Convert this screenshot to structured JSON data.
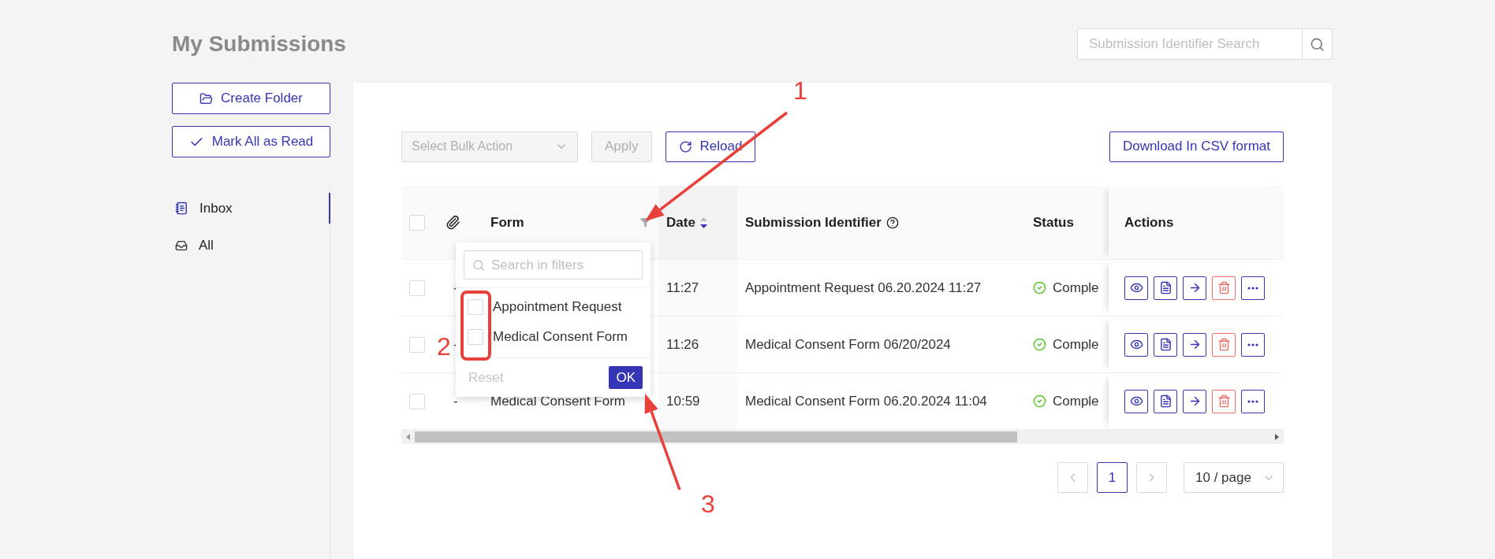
{
  "page": {
    "title": "My Submissions"
  },
  "search": {
    "placeholder": "Submission Identifier Search"
  },
  "sidebar": {
    "buttons": [
      {
        "label": "Create Folder",
        "kind": "folder"
      },
      {
        "label": "Mark All as Read",
        "kind": "check"
      }
    ],
    "items": [
      {
        "label": "Inbox",
        "kind": "inbox",
        "selected": true
      },
      {
        "label": "All",
        "kind": "all",
        "selected": false
      }
    ]
  },
  "toolbar": {
    "bulk_action": {
      "placeholder": "Select Bulk Action",
      "disabled": true
    },
    "apply": {
      "label": "Apply",
      "disabled": true
    },
    "reload": {
      "label": "Reload"
    },
    "download": {
      "label": "Download In CSV format"
    }
  },
  "table": {
    "select_all_checked": false,
    "columns": [
      {
        "kind": "select"
      },
      {
        "kind": "attachment"
      },
      {
        "label": "Form",
        "kind": "filter"
      },
      {
        "label": "Date",
        "kind": "sort",
        "sort_descending": true
      },
      {
        "label": "Submission Identifier",
        "kind": "help"
      },
      {
        "label": "Status",
        "kind": "text"
      },
      {
        "label": "Actions",
        "kind": "text"
      }
    ],
    "rows": [
      {
        "checked": false,
        "attachment": "-",
        "date": "11:27",
        "identifier": "Appointment Request 06.20.2024 11:27",
        "status": "Comple"
      },
      {
        "checked": false,
        "attachment": "-",
        "date": "11:26",
        "identifier": "Medical Consent Form 06/20/2024",
        "status": "Comple"
      },
      {
        "checked": false,
        "attachment": "-",
        "form": "Medical Consent Form",
        "date": "10:59",
        "identifier": "Medical Consent Form 06.20.2024 11:04",
        "status": "Comple"
      }
    ],
    "actions": [
      {
        "kind": "view"
      },
      {
        "kind": "pdf"
      },
      {
        "kind": "forward"
      },
      {
        "kind": "delete"
      },
      {
        "kind": "more"
      }
    ]
  },
  "filter_dropdown": {
    "search_placeholder": "Search in filters",
    "options": [
      {
        "label": "Appointment Request",
        "checked": false
      },
      {
        "label": "Medical Consent Form",
        "checked": false
      }
    ],
    "reset": {
      "label": "Reset",
      "disabled": true
    },
    "ok": {
      "label": "OK"
    }
  },
  "pagination": {
    "previous_disabled": true,
    "pages": [
      {
        "label": "1",
        "selected": true
      }
    ],
    "next_disabled": true,
    "page_size": "10 / page"
  },
  "annotations": [
    {
      "label": "1",
      "kind": "arrow"
    },
    {
      "label": "2",
      "kind": "frame"
    },
    {
      "label": "3",
      "kind": "arrow"
    }
  ]
}
